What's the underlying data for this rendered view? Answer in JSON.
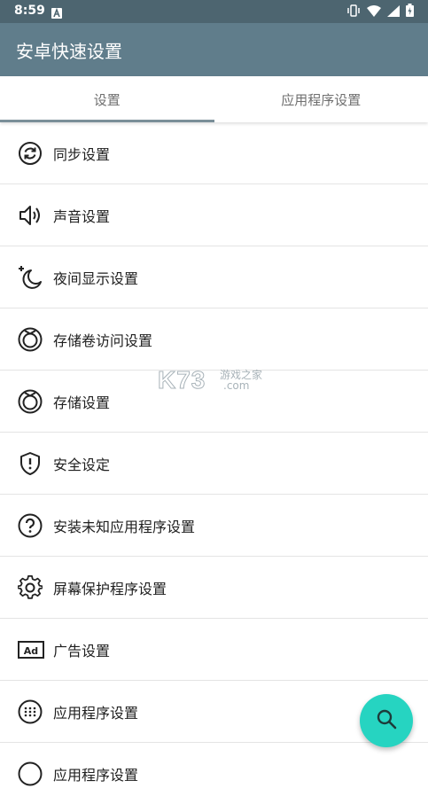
{
  "status_bar": {
    "time": "8:59",
    "notification_icon": "a-icon",
    "icons": [
      "vibrate-icon",
      "wifi-icon",
      "signal-icon",
      "battery-icon"
    ]
  },
  "app_bar": {
    "title": "安卓快速设置"
  },
  "tabs": [
    {
      "label": "设置",
      "active": true
    },
    {
      "label": "应用程序设置",
      "active": false
    }
  ],
  "items": [
    {
      "label": "同步设置",
      "icon": "sync-icon"
    },
    {
      "label": "声音设置",
      "icon": "volume-icon"
    },
    {
      "label": "夜间显示设置",
      "icon": "night-mode-icon"
    },
    {
      "label": "存储卷访问设置",
      "icon": "storage-volume-icon"
    },
    {
      "label": "存储设置",
      "icon": "storage-icon"
    },
    {
      "label": "安全设定",
      "icon": "security-shield-icon"
    },
    {
      "label": "安装未知应用程序设置",
      "icon": "help-circle-icon"
    },
    {
      "label": "屏幕保护程序设置",
      "icon": "gear-icon"
    },
    {
      "label": "广告设置",
      "icon": "ad-icon"
    },
    {
      "label": "应用程序设置",
      "icon": "apps-circle-icon"
    },
    {
      "label": "应用程序设置",
      "icon": "apps-circle-icon"
    }
  ],
  "fab": {
    "icon": "search-icon"
  },
  "watermark": {
    "brand": "K73",
    "text1": "游戏之家",
    "text2": ".com"
  },
  "colors": {
    "status_bar": "#4d6570",
    "app_bar": "#607d8b",
    "fab": "#26d4c1",
    "tab_indicator": "#7a8f99"
  }
}
